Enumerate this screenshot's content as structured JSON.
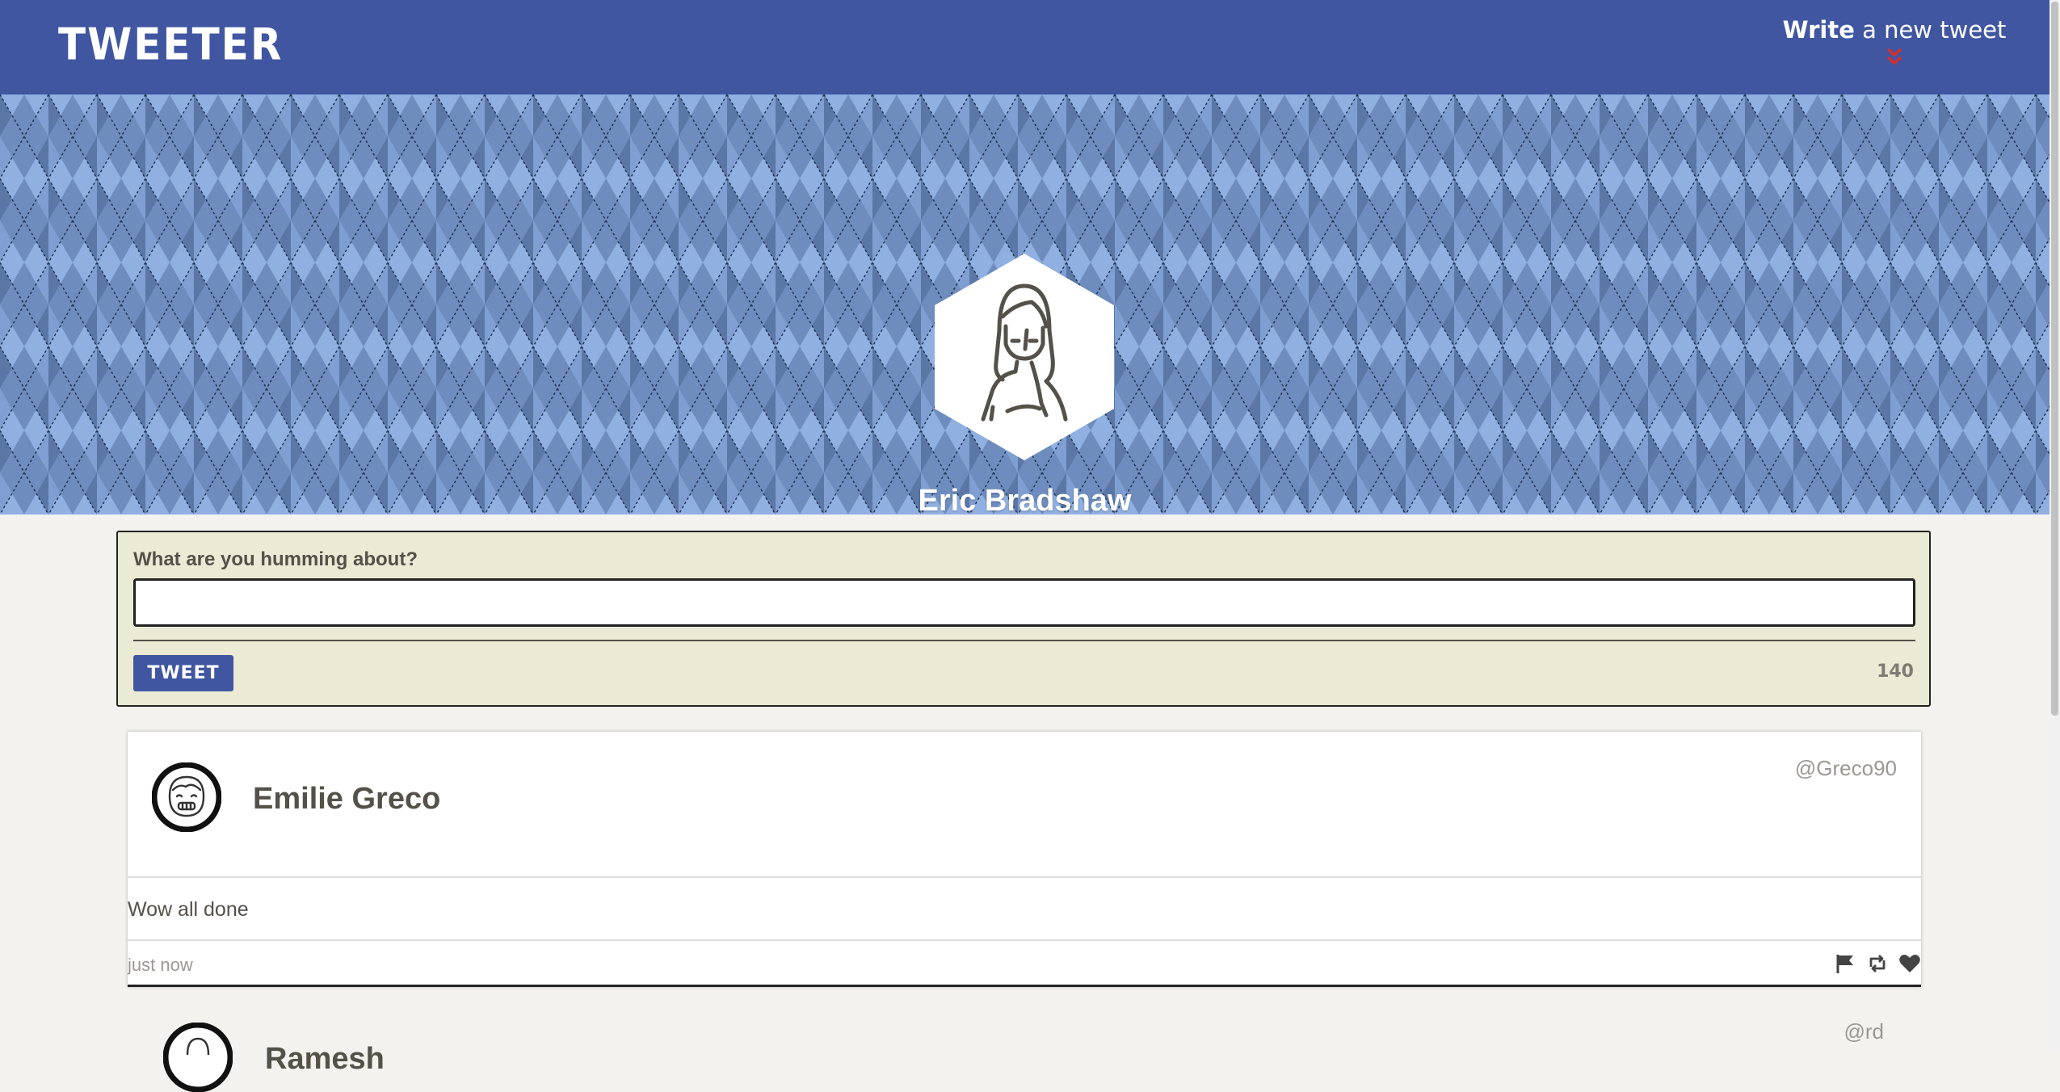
{
  "nav": {
    "logo": "TWEETER",
    "compose_bold": "Write",
    "compose_rest": " a new tweet"
  },
  "profile": {
    "name": "Eric Bradshaw"
  },
  "compose": {
    "label": "What are you humming about?",
    "input_value": "",
    "button_label": "TWEET",
    "counter": "140"
  },
  "tweets": [
    {
      "name": "Emilie Greco",
      "handle": "@Greco90",
      "body": "Wow all done",
      "time": "just now",
      "actions": [
        "flag-icon",
        "retweet-icon",
        "heart-icon"
      ]
    },
    {
      "name": "Ramesh",
      "handle": "@rd"
    }
  ],
  "colors": {
    "nav_bg": "#4056a1",
    "accent_red": "#d32f2f",
    "compose_bg": "#eaead5",
    "page_bg": "#f3f2ee"
  }
}
